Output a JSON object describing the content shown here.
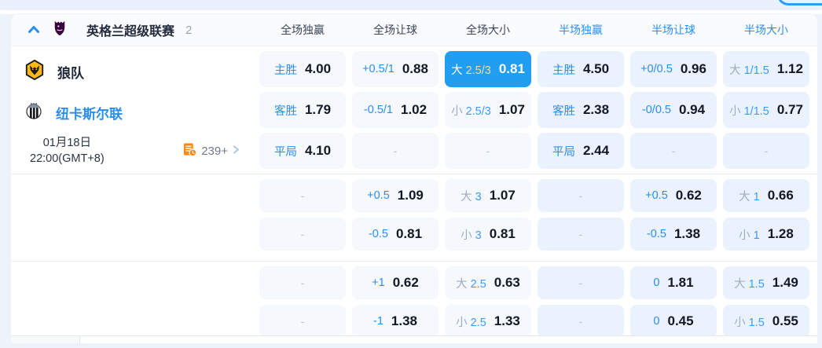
{
  "league_header": {
    "name": "英格兰超级联赛",
    "count": "2",
    "columns": [
      {
        "label": "全场独赢",
        "scope": "full"
      },
      {
        "label": "全场让球",
        "scope": "full"
      },
      {
        "label": "全场大小",
        "scope": "full"
      },
      {
        "label": "半场独赢",
        "scope": "half"
      },
      {
        "label": "半场让球",
        "scope": "half"
      },
      {
        "label": "半场大小",
        "scope": "half"
      }
    ]
  },
  "match": {
    "home_team": "狼队",
    "away_team": "纽卡斯尔联",
    "date": "01月18日",
    "time": "22:00(GMT+8)",
    "more_markets": "239+"
  },
  "odds_rows": [
    {
      "cells": [
        {
          "label": "主胜",
          "value": "4.00"
        },
        {
          "label": "+0.5/1",
          "value": "0.88"
        },
        {
          "side": "大",
          "line": "2.5/3",
          "value": "0.81",
          "selected": true
        },
        {
          "label": "主胜",
          "value": "4.50",
          "half": true
        },
        {
          "label": "+0/0.5",
          "value": "0.96",
          "half": true
        },
        {
          "side": "大",
          "line": "1/1.5",
          "value": "1.12",
          "half": true
        }
      ]
    },
    {
      "cells": [
        {
          "label": "客胜",
          "value": "1.79"
        },
        {
          "label": "-0.5/1",
          "value": "1.02"
        },
        {
          "side": "小",
          "line": "2.5/3",
          "value": "1.07"
        },
        {
          "label": "客胜",
          "value": "2.38",
          "half": true
        },
        {
          "label": "-0/0.5",
          "value": "0.94",
          "half": true
        },
        {
          "side": "小",
          "line": "1/1.5",
          "value": "0.77",
          "half": true
        }
      ]
    },
    {
      "cells": [
        {
          "label": "平局",
          "value": "4.10"
        },
        {
          "dash": true
        },
        {
          "dash": true
        },
        {
          "label": "平局",
          "value": "2.44",
          "half": true
        },
        {
          "dash": true,
          "half": true
        },
        {
          "dash": true,
          "half": true
        }
      ]
    },
    {
      "cells": [
        {
          "dash": true
        },
        {
          "label": "+0.5",
          "value": "1.09"
        },
        {
          "side": "大",
          "line": "3",
          "value": "1.07"
        },
        {
          "dash": true,
          "half": true
        },
        {
          "label": "+0.5",
          "value": "0.62",
          "half": true
        },
        {
          "side": "大",
          "line": "1",
          "value": "0.66",
          "half": true
        }
      ]
    },
    {
      "cells": [
        {
          "dash": true
        },
        {
          "label": "-0.5",
          "value": "0.81"
        },
        {
          "side": "小",
          "line": "3",
          "value": "0.81"
        },
        {
          "dash": true,
          "half": true
        },
        {
          "label": "-0.5",
          "value": "1.38",
          "half": true
        },
        {
          "side": "小",
          "line": "1",
          "value": "1.28",
          "half": true
        }
      ]
    },
    {
      "cells": [
        {
          "dash": true
        },
        {
          "label": "+1",
          "value": "0.62"
        },
        {
          "side": "大",
          "line": "2.5",
          "value": "0.63"
        },
        {
          "dash": true,
          "half": true
        },
        {
          "label": "0",
          "value": "1.81",
          "half": true
        },
        {
          "side": "大",
          "line": "1.5",
          "value": "1.49",
          "half": true
        }
      ]
    },
    {
      "cells": [
        {
          "dash": true
        },
        {
          "label": "-1",
          "value": "1.38"
        },
        {
          "side": "小",
          "line": "2.5",
          "value": "1.33"
        },
        {
          "dash": true,
          "half": true
        },
        {
          "label": "0",
          "value": "0.45",
          "half": true
        },
        {
          "side": "小",
          "line": "1.5",
          "value": "0.55",
          "half": true
        }
      ]
    }
  ],
  "icons": {
    "collapse": "chevron-up-icon",
    "league_logo": "premier-league-lion-icon",
    "home_badge": "wolves-crest-icon",
    "away_badge": "newcastle-crest-icon",
    "more_markets": "markets-list-clock-icon",
    "more_arrow": "chevron-right-icon"
  },
  "colors": {
    "accent_blue": "#2b8ded",
    "selected_cell_bg": "#219df2",
    "selected_line_text": "#eede9d",
    "cell_bg_full": "#f5f8fd",
    "cell_bg_half": "#eaf2fd",
    "value_text": "#121824",
    "ou_side_grey": "#9fadc0",
    "dash_grey": "#b6c2d2",
    "wolves_gold": "#fdb913",
    "pl_purple": "#38003c",
    "more_icon_orange": "#fa8c16"
  }
}
